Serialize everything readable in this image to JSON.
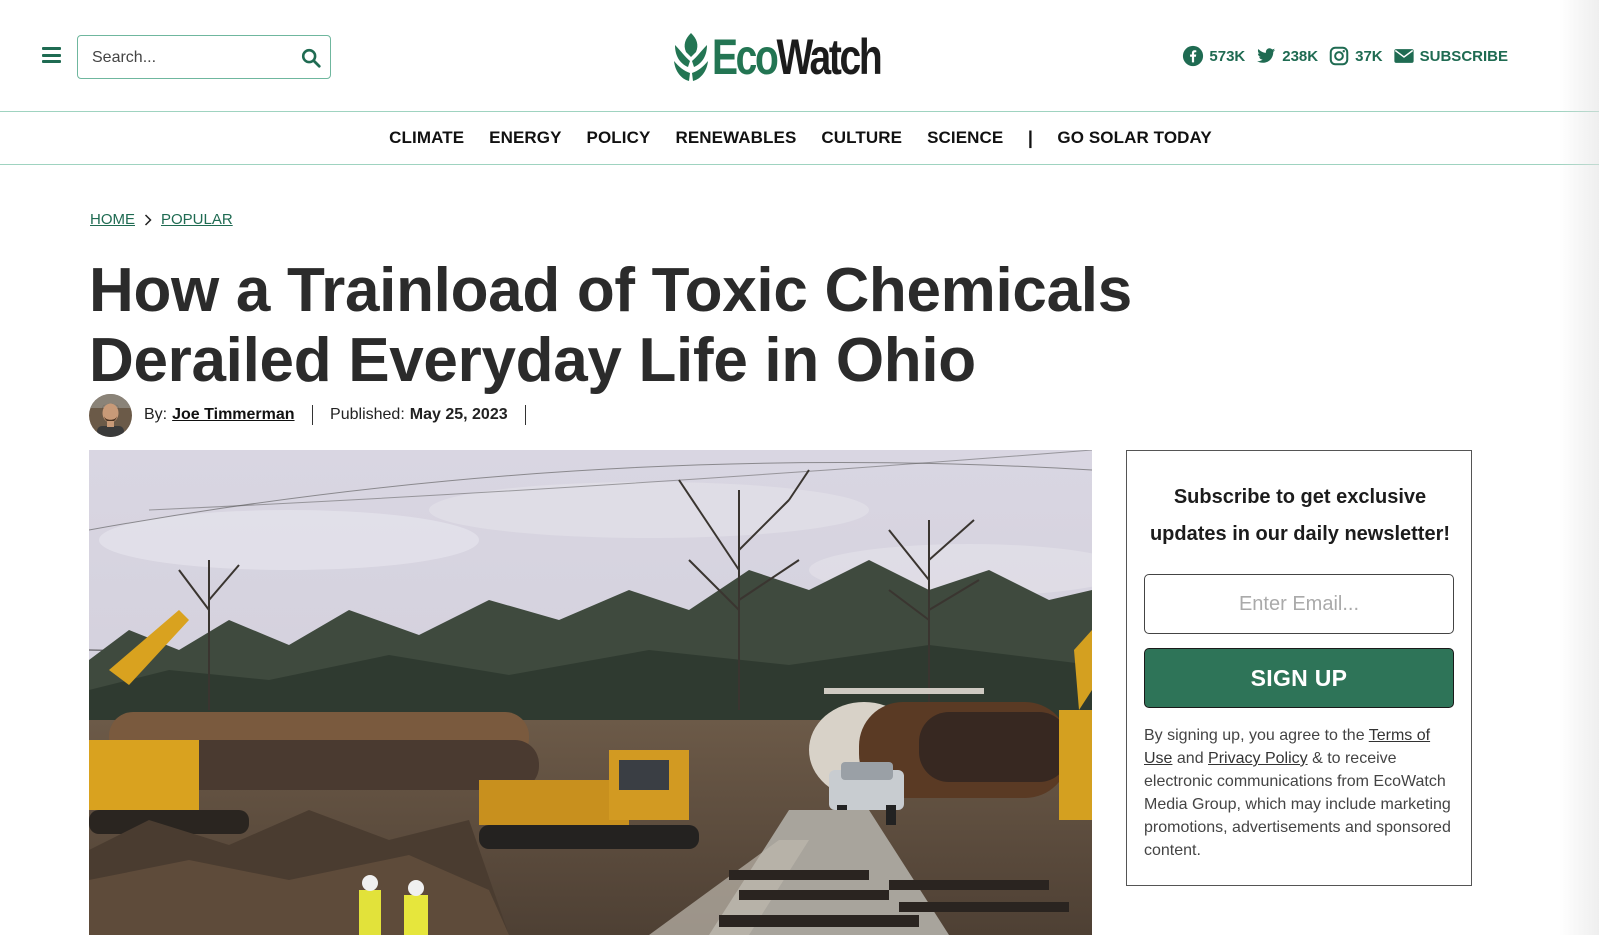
{
  "header": {
    "search_placeholder": "Search...",
    "logo": {
      "eco": "Eco",
      "watch": "Watch"
    },
    "social": [
      {
        "icon": "facebook-icon",
        "count": "573K"
      },
      {
        "icon": "twitter-icon",
        "count": "238K"
      },
      {
        "icon": "instagram-icon",
        "count": "37K"
      },
      {
        "icon": "envelope-icon",
        "count": "SUBSCRIBE"
      }
    ]
  },
  "nav": {
    "items": [
      "CLIMATE",
      "ENERGY",
      "POLICY",
      "RENEWABLES",
      "CULTURE",
      "SCIENCE"
    ],
    "separator": "|",
    "cta": "GO SOLAR TODAY"
  },
  "breadcrumb": {
    "home": "HOME",
    "section": "POPULAR"
  },
  "article": {
    "title_line1": "How a Trainload of Toxic Chemicals",
    "title_line2": "Derailed Everyday Life in Ohio",
    "by_label": "By:",
    "author": "Joe Timmerman",
    "published_label": "Published:",
    "published_date": "May 25, 2023"
  },
  "newsletter": {
    "heading_line1": "Subscribe to get exclusive",
    "heading_line2": "updates in our daily newsletter!",
    "email_placeholder": "Enter Email...",
    "button": "SIGN UP",
    "legal_1": "By signing up, you agree to the ",
    "terms_link": "Terms of Use",
    "legal_2": " and ",
    "privacy_link": "Privacy Policy",
    "legal_3": " & to receive electronic communications from EcoWatch Media Group, which may include marketing promotions, advertisements and sponsored content."
  },
  "colors": {
    "brand_green": "#237553",
    "button_green": "#2e7458",
    "accent_line": "#9fd3c0"
  }
}
